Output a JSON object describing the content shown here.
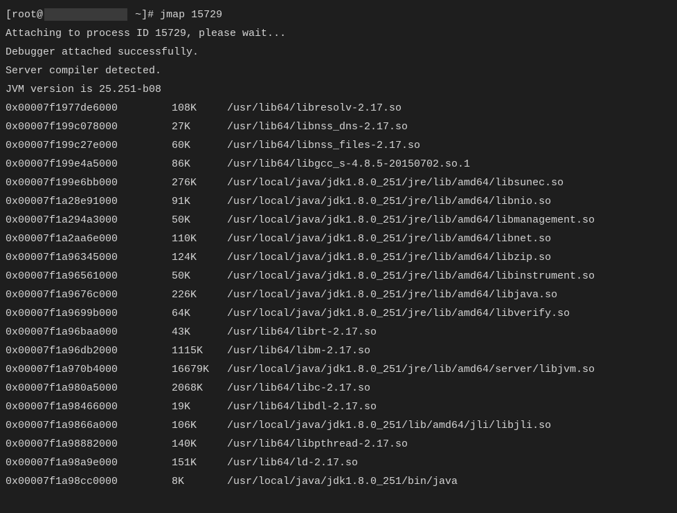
{
  "prompt": {
    "user": "root",
    "at": "@",
    "hostMasked": true,
    "cwd": "~",
    "promptChar": "#",
    "command": "jmap 15729"
  },
  "messages": [
    "Attaching to process ID 15729, please wait...",
    "Debugger attached successfully.",
    "Server compiler detected.",
    "JVM version is 25.251-b08"
  ],
  "rows": [
    {
      "addr": "0x00007f1977de6000",
      "size": "108K",
      "path": "/usr/lib64/libresolv-2.17.so"
    },
    {
      "addr": "0x00007f199c078000",
      "size": "27K",
      "path": "/usr/lib64/libnss_dns-2.17.so"
    },
    {
      "addr": "0x00007f199c27e000",
      "size": "60K",
      "path": "/usr/lib64/libnss_files-2.17.so"
    },
    {
      "addr": "0x00007f199e4a5000",
      "size": "86K",
      "path": "/usr/lib64/libgcc_s-4.8.5-20150702.so.1"
    },
    {
      "addr": "0x00007f199e6bb000",
      "size": "276K",
      "path": "/usr/local/java/jdk1.8.0_251/jre/lib/amd64/libsunec.so"
    },
    {
      "addr": "0x00007f1a28e91000",
      "size": "91K",
      "path": "/usr/local/java/jdk1.8.0_251/jre/lib/amd64/libnio.so"
    },
    {
      "addr": "0x00007f1a294a3000",
      "size": "50K",
      "path": "/usr/local/java/jdk1.8.0_251/jre/lib/amd64/libmanagement.so"
    },
    {
      "addr": "0x00007f1a2aa6e000",
      "size": "110K",
      "path": "/usr/local/java/jdk1.8.0_251/jre/lib/amd64/libnet.so"
    },
    {
      "addr": "0x00007f1a96345000",
      "size": "124K",
      "path": "/usr/local/java/jdk1.8.0_251/jre/lib/amd64/libzip.so"
    },
    {
      "addr": "0x00007f1a96561000",
      "size": "50K",
      "path": "/usr/local/java/jdk1.8.0_251/jre/lib/amd64/libinstrument.so"
    },
    {
      "addr": "0x00007f1a9676c000",
      "size": "226K",
      "path": "/usr/local/java/jdk1.8.0_251/jre/lib/amd64/libjava.so"
    },
    {
      "addr": "0x00007f1a9699b000",
      "size": "64K",
      "path": "/usr/local/java/jdk1.8.0_251/jre/lib/amd64/libverify.so"
    },
    {
      "addr": "0x00007f1a96baa000",
      "size": "43K",
      "path": "/usr/lib64/librt-2.17.so"
    },
    {
      "addr": "0x00007f1a96db2000",
      "size": "1115K",
      "path": "/usr/lib64/libm-2.17.so"
    },
    {
      "addr": "0x00007f1a970b4000",
      "size": "16679K",
      "path": "/usr/local/java/jdk1.8.0_251/jre/lib/amd64/server/libjvm.so"
    },
    {
      "addr": "0x00007f1a980a5000",
      "size": "2068K",
      "path": "/usr/lib64/libc-2.17.so"
    },
    {
      "addr": "0x00007f1a98466000",
      "size": "19K",
      "path": "/usr/lib64/libdl-2.17.so"
    },
    {
      "addr": "0x00007f1a9866a000",
      "size": "106K",
      "path": "/usr/local/java/jdk1.8.0_251/lib/amd64/jli/libjli.so"
    },
    {
      "addr": "0x00007f1a98882000",
      "size": "140K",
      "path": "/usr/lib64/libpthread-2.17.so"
    },
    {
      "addr": "0x00007f1a98a9e000",
      "size": "151K",
      "path": "/usr/lib64/ld-2.17.so"
    },
    {
      "addr": "0x00007f1a98cc0000",
      "size": "8K",
      "path": "/usr/local/java/jdk1.8.0_251/bin/java"
    }
  ]
}
